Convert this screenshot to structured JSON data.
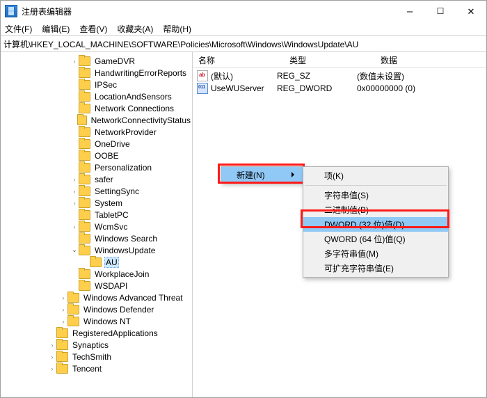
{
  "title": "注册表编辑器",
  "menu": [
    "文件(F)",
    "编辑(E)",
    "查看(V)",
    "收藏夹(A)",
    "帮助(H)"
  ],
  "address": "计算机\\HKEY_LOCAL_MACHINE\\SOFTWARE\\Policies\\Microsoft\\Windows\\WindowsUpdate\\AU",
  "tree": [
    {
      "d": 6,
      "c": ">",
      "label": "GameDVR"
    },
    {
      "d": 6,
      "c": "",
      "label": "HandwritingErrorReports"
    },
    {
      "d": 6,
      "c": "",
      "label": "IPSec"
    },
    {
      "d": 6,
      "c": "",
      "label": "LocationAndSensors"
    },
    {
      "d": 6,
      "c": "",
      "label": "Network Connections"
    },
    {
      "d": 6,
      "c": "",
      "label": "NetworkConnectivityStatus"
    },
    {
      "d": 6,
      "c": "",
      "label": "NetworkProvider"
    },
    {
      "d": 6,
      "c": "",
      "label": "OneDrive"
    },
    {
      "d": 6,
      "c": "",
      "label": "OOBE"
    },
    {
      "d": 6,
      "c": "",
      "label": "Personalization"
    },
    {
      "d": 6,
      "c": ">",
      "label": "safer"
    },
    {
      "d": 6,
      "c": ">",
      "label": "SettingSync"
    },
    {
      "d": 6,
      "c": ">",
      "label": "System"
    },
    {
      "d": 6,
      "c": "",
      "label": "TabletPC"
    },
    {
      "d": 6,
      "c": ">",
      "label": "WcmSvc"
    },
    {
      "d": 6,
      "c": "",
      "label": "Windows Search"
    },
    {
      "d": 6,
      "c": "v",
      "label": "WindowsUpdate"
    },
    {
      "d": 7,
      "c": "",
      "label": "AU",
      "sel": true
    },
    {
      "d": 6,
      "c": "",
      "label": "WorkplaceJoin"
    },
    {
      "d": 6,
      "c": "",
      "label": "WSDAPI"
    },
    {
      "d": 5,
      "c": ">",
      "label": "Windows Advanced Threat"
    },
    {
      "d": 5,
      "c": ">",
      "label": "Windows Defender"
    },
    {
      "d": 5,
      "c": ">",
      "label": "Windows NT"
    },
    {
      "d": 4,
      "c": "",
      "label": "RegisteredApplications"
    },
    {
      "d": 4,
      "c": ">",
      "label": "Synaptics"
    },
    {
      "d": 4,
      "c": ">",
      "label": "TechSmith"
    },
    {
      "d": 4,
      "c": ">",
      "label": "Tencent"
    }
  ],
  "columns": {
    "name": "名称",
    "type": "类型",
    "data": "数据"
  },
  "values": [
    {
      "icon": "str",
      "name": "(默认)",
      "type": "REG_SZ",
      "data": "(数值未设置)"
    },
    {
      "icon": "bin",
      "name": "UseWUServer",
      "type": "REG_DWORD",
      "data": "0x00000000 (0)"
    }
  ],
  "ctx1": {
    "new": "新建(N)"
  },
  "ctx2": {
    "key": "项(K)",
    "sz": "字符串值(S)",
    "bin": "二进制值(B)",
    "dword": "DWORD (32 位)值(D)",
    "qword": "QWORD (64 位)值(Q)",
    "multi": "多字符串值(M)",
    "expand": "可扩充字符串值(E)"
  }
}
